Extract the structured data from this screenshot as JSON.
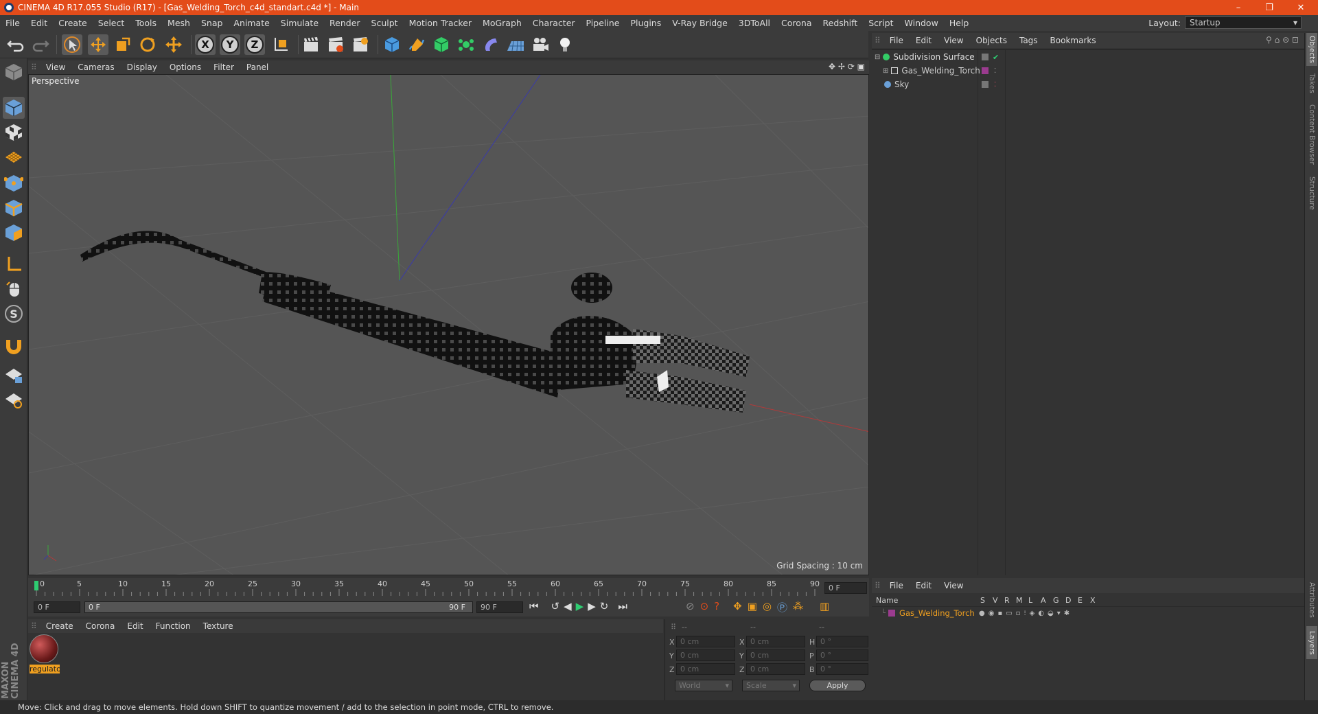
{
  "window": {
    "title": "CINEMA 4D R17.055 Studio (R17) - [Gas_Welding_Torch_c4d_standart.c4d *] - Main",
    "minimize": "–",
    "restore": "❐",
    "close": "✕"
  },
  "menu": [
    "File",
    "Edit",
    "Create",
    "Select",
    "Tools",
    "Mesh",
    "Snap",
    "Animate",
    "Simulate",
    "Render",
    "Sculpt",
    "Motion Tracker",
    "MoGraph",
    "Character",
    "Pipeline",
    "Plugins",
    "V-Ray Bridge",
    "3DToAll",
    "Corona",
    "Redshift",
    "Script",
    "Window",
    "Help"
  ],
  "layout": {
    "label": "Layout:",
    "value": "Startup"
  },
  "axis_labels": [
    "X",
    "Y",
    "Z"
  ],
  "viewport": {
    "menu": [
      "View",
      "Cameras",
      "Display",
      "Options",
      "Filter",
      "Panel"
    ],
    "label": "Perspective",
    "grid_spacing": "Grid Spacing : 10 cm"
  },
  "timeline": {
    "ticks": [
      "0",
      "5",
      "10",
      "15",
      "20",
      "25",
      "30",
      "35",
      "40",
      "45",
      "50",
      "55",
      "60",
      "65",
      "70",
      "75",
      "80",
      "85",
      "90"
    ],
    "current": "0 F",
    "start": "0 F",
    "range_start": "0 F",
    "range_end": "90 F",
    "end": "90 F"
  },
  "material_panel": {
    "menu": [
      "Create",
      "Corona",
      "Edit",
      "Function",
      "Texture"
    ],
    "material_name": "regulato"
  },
  "coords": {
    "head": [
      "--",
      "--",
      "--"
    ],
    "rows": [
      {
        "a": "X",
        "av": "0 cm",
        "b": "X",
        "bv": "0 cm",
        "c": "H",
        "cv": "0 °"
      },
      {
        "a": "Y",
        "av": "0 cm",
        "b": "Y",
        "bv": "0 cm",
        "c": "P",
        "cv": "0 °"
      },
      {
        "a": "Z",
        "av": "0 cm",
        "b": "Z",
        "bv": "0 cm",
        "c": "B",
        "cv": "0 °"
      }
    ],
    "world": "World",
    "scale": "Scale",
    "apply": "Apply"
  },
  "objects_panel": {
    "menu": [
      "File",
      "Edit",
      "View",
      "Objects",
      "Tags",
      "Bookmarks"
    ],
    "items": [
      {
        "name": "Subdivision Surface",
        "color": "#33cc66"
      },
      {
        "name": "Gas_Welding_Torch",
        "color": "#9b3b8f"
      },
      {
        "name": "Sky",
        "color": "#6aa0d8"
      }
    ]
  },
  "layers_panel": {
    "menu": [
      "File",
      "Edit",
      "View"
    ],
    "headers": [
      "Name",
      "S",
      "V",
      "R",
      "M",
      "L",
      "A",
      "G",
      "D",
      "E",
      "X"
    ],
    "items": [
      {
        "name": "Gas_Welding_Torch",
        "color": "#9b3b8f"
      }
    ]
  },
  "right_tabs": [
    "Objects",
    "Takes",
    "Content Browser",
    "Structure",
    "Attributes",
    "Layers"
  ],
  "status": "Move: Click and drag to move elements. Hold down SHIFT to quantize movement / add to the selection in point mode, CTRL to remove.",
  "brand": "MAXON CINEMA 4D"
}
